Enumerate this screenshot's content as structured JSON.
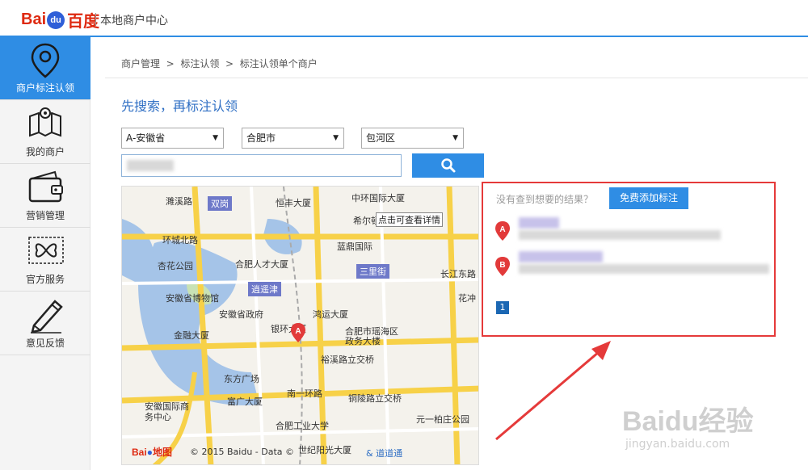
{
  "header": {
    "logo_text": "Bai",
    "logo_paw": "du",
    "logo_cn": "百度",
    "title": "本地商户中心"
  },
  "sidebar": {
    "items": [
      {
        "label": "商户标注认领",
        "icon": "location-pin-icon",
        "active": true
      },
      {
        "label": "我的商户",
        "icon": "map-icon"
      },
      {
        "label": "营销管理",
        "icon": "wallet-icon"
      },
      {
        "label": "官方服务",
        "icon": "service-icon"
      },
      {
        "label": "意见反馈",
        "icon": "pencil-icon"
      }
    ]
  },
  "breadcrumb": {
    "items": [
      "商户管理",
      "标注认领",
      "标注认领单个商户"
    ],
    "sep": ">"
  },
  "page_title": "先搜索，再标注认领",
  "filters": {
    "province": "A-安徽省",
    "city": "合肥市",
    "district": "包河区"
  },
  "map": {
    "labels": [
      "濉溪路",
      "双岗",
      "恒丰大厦",
      "中环国际大厦",
      "希尔顿",
      "点击可查看详情",
      "环城北路",
      "蓝鼎国际",
      "杏花公园",
      "合肥人才大厦",
      "三里街",
      "长江东路",
      "逍遥津",
      "安徽省博物馆",
      "安徽省政府",
      "鸿运大厦",
      "花冲",
      "金融大厦",
      "银环大厦",
      "合肥市瑶海区政务大楼",
      "裕溪路立交桥",
      "东方广场",
      "富广大厦",
      "南一环路",
      "铜陵路立交桥",
      "安徽国际商务中心",
      "合肥工业大学",
      "元一柏庄公园",
      "世纪阳光大厦"
    ],
    "copyright": "© 2015 Baidu - Data ©",
    "copyright_tail": "& 道道通",
    "logo_text": "Bai",
    "logo_cn": "地图"
  },
  "results": {
    "noresult": "没有查到想要的结果？",
    "add_label": "免费添加标注",
    "markers": [
      "A",
      "B"
    ],
    "page": "1"
  },
  "watermark": {
    "brand": "Baidu经验",
    "url": "jingyan.baidu.com"
  },
  "colors": {
    "accent": "#2f8de4",
    "highlight": "#e53a3a"
  }
}
